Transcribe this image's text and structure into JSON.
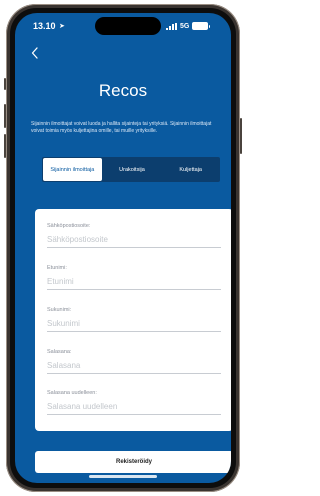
{
  "status_bar": {
    "time": "13.10",
    "location_icon": "location-arrow-icon",
    "network": "5G",
    "signal_icon": "signal-bars-icon",
    "battery_icon": "battery-icon"
  },
  "nav": {
    "back_icon": "chevron-left-icon"
  },
  "app": {
    "title": "Recos",
    "description": "Sijainnin ilmoittajat voivat luoda ja hallita sijainteja tai yrityksiä. Sijainnin ilmoittajat voivat toimia myös kuljettajina omille, tai muille yrityksille."
  },
  "tabs": [
    {
      "label": "Sijainnin ilmoittaja",
      "active": true
    },
    {
      "label": "Urakoitsija",
      "active": false
    },
    {
      "label": "Kuljettaja",
      "active": false
    }
  ],
  "form": {
    "fields": [
      {
        "label": "Sähköpostiosoite:",
        "placeholder": "Sähköpostiosoite",
        "value": ""
      },
      {
        "label": "Etunimi:",
        "placeholder": "Etunimi",
        "value": ""
      },
      {
        "label": "Sukunimi:",
        "placeholder": "Sukunimi",
        "value": ""
      },
      {
        "label": "Salasana:",
        "placeholder": "Salasana",
        "value": ""
      },
      {
        "label": "Salasana uudelleen:",
        "placeholder": "Salasana uudelleen",
        "value": ""
      }
    ],
    "submit_label": "Rekisteröidy"
  },
  "colors": {
    "background": "#0a5aa0",
    "tab_bar": "#0c3e6e",
    "card": "#ffffff"
  }
}
